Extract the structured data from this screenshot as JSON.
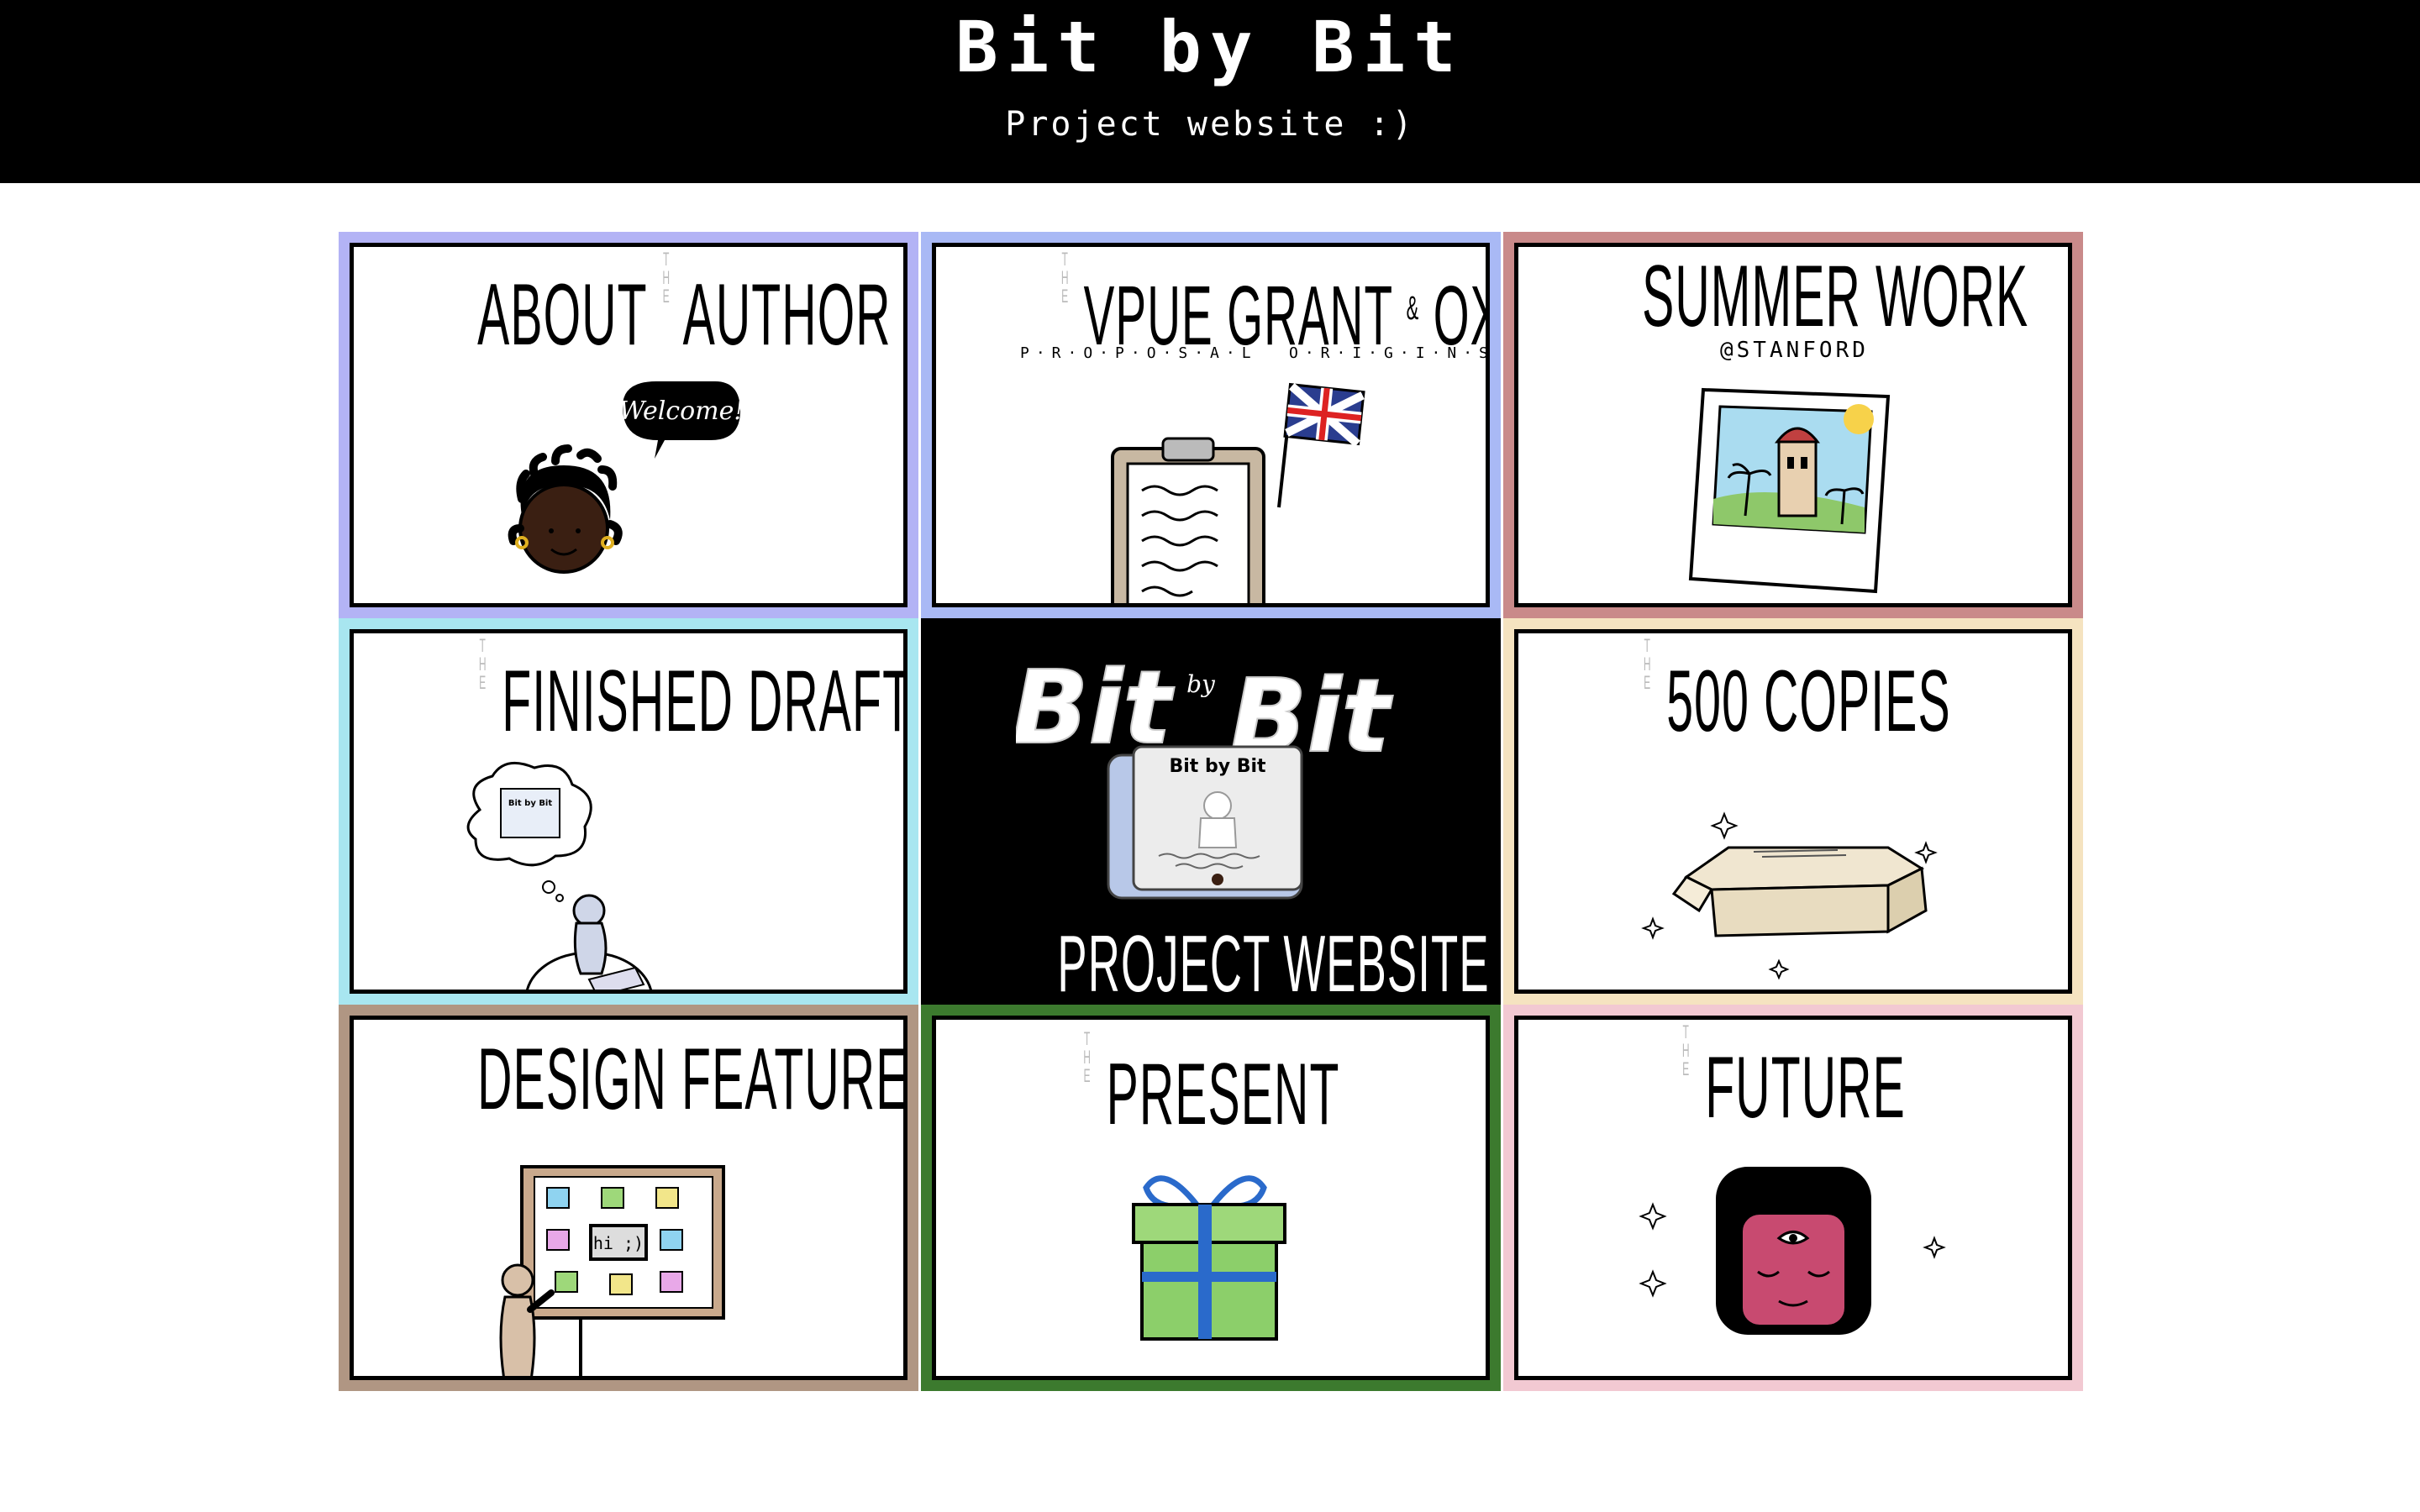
{
  "header": {
    "title": "Bit by Bit",
    "subtitle": "Project website :)"
  },
  "tiles": [
    {
      "title_a": "ABOUT",
      "the": "THE",
      "title_b": "AUTHOR",
      "speech": "Welcome!",
      "border": "#b3b3f5"
    },
    {
      "the": "THE",
      "title_a": "VPUE GRANT",
      "amp": "&",
      "title_b": "OXFORD",
      "sub_a": "P·R·O·P·O·S·A·L",
      "sub_b": "O·R·I·G·I·N·S",
      "border": "#a9b9f5"
    },
    {
      "title": "SUMMER WORK",
      "sub": "@STANFORD",
      "border": "#c98a8a"
    },
    {
      "the": "THE",
      "title": "FINISHED DRAFT",
      "book": "Bit by Bit",
      "border": "#a8e6f0"
    },
    {
      "logo_a": "Bit",
      "logo_by": "by",
      "logo_b": "Bit",
      "book": "Bit by Bit",
      "title": "PROJECT WEBSITE",
      "border": "#000000"
    },
    {
      "the": "THE",
      "title": "500 COPIES",
      "border": "#f5e3c0"
    },
    {
      "title": "DESIGN FEATURES",
      "note": "hi ;)",
      "border": "#b09683"
    },
    {
      "the": "THE",
      "title": "PRESENT",
      "border": "#3c7a2e"
    },
    {
      "the": "THE",
      "title": "FUTURE",
      "border": "#f2c9d2"
    }
  ],
  "colors": {
    "header_bg": "#000000",
    "page_bg": "#ffffff"
  }
}
